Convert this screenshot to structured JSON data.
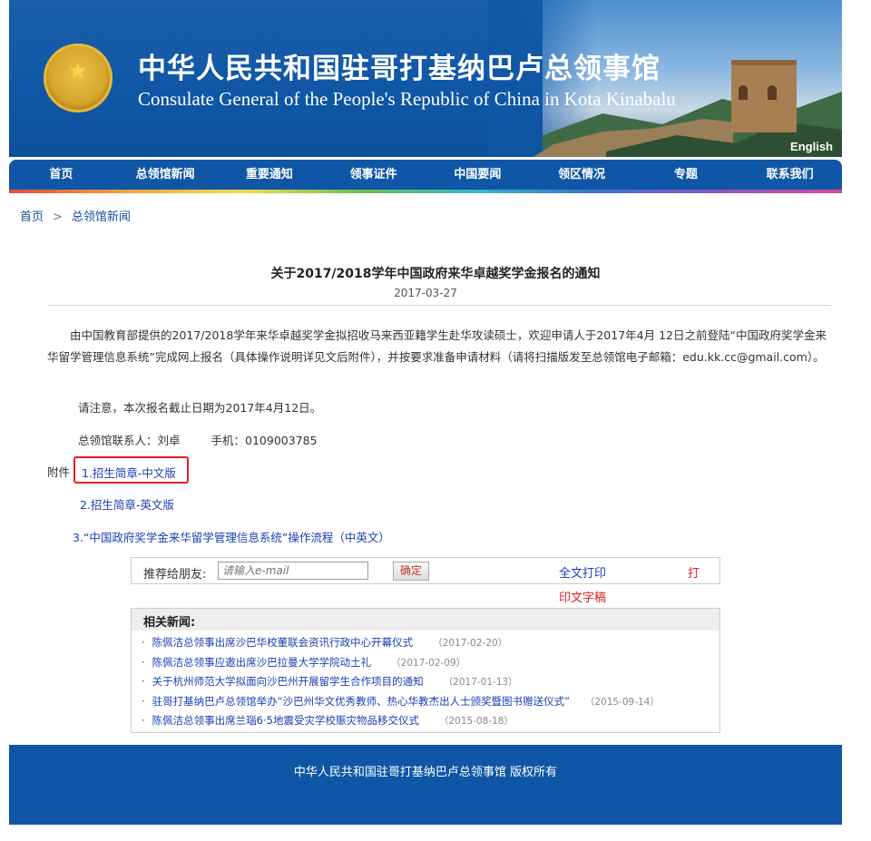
{
  "header": {
    "title_cn": "中华人民共和国驻哥打基纳巴卢总领事馆",
    "title_en": "Consulate General of the People's Republic of China in Kota Kinabalu",
    "english_link": "English",
    "emblem_icon": "national-emblem-icon"
  },
  "nav": {
    "items": [
      {
        "label": "首页"
      },
      {
        "label": "总领馆新闻"
      },
      {
        "label": "重要通知"
      },
      {
        "label": "领事证件"
      },
      {
        "label": "中国要闻"
      },
      {
        "label": "领区情况"
      },
      {
        "label": "专题"
      },
      {
        "label": "联系我们"
      }
    ]
  },
  "breadcrumb": {
    "home": "首页",
    "separator": ">",
    "current": "总领馆新闻"
  },
  "article": {
    "title": "关于2017/2018学年中国政府来华卓越奖学金报名的通知",
    "date": "2017-03-27",
    "para1": "由中国教育部提供的2017/2018学年来华卓越奖学金拟招收马来西亚籍学生赴华攻读硕士，欢迎申请人于2017年4月 12日之前登陆“中国政府奖学金来华留学管理信息系统”完成网上报名（具体操作说明详见文后附件），并按要求准备申请材料（请将扫描版发至总领馆电子邮箱：edu.kk.cc@gmail.com）。",
    "para2": "请注意，本次报名截止日期为2017年4月12日。",
    "contact_label": "总领馆联系人：刘卓",
    "phone_label": "手机：0109003785",
    "attachments_label": "附件",
    "attachments": [
      "1.招生简章-中文版",
      "2.招生简章-英文版",
      "3.“中国政府奖学金来华留学管理信息系统”操作流程（中英文）"
    ]
  },
  "recommend": {
    "label": "推荐给朋友:",
    "placeholder": "请输入e-mail",
    "button": "确定",
    "print_full": "全文打印",
    "print_part1": "打",
    "print_part2": "印文字稿"
  },
  "related": {
    "heading": "相关新闻:",
    "items": [
      {
        "title": "陈佩洁总领事出席沙巴华校董联会资讯行政中心开幕仪式",
        "date": "（2017-02-20）"
      },
      {
        "title": "陈佩洁总领事应邀出席沙巴拉曼大学学院动土礼",
        "date": "（2017-02-09）"
      },
      {
        "title": "关于杭州师范大学拟面向沙巴州开展留学生合作项目的通知",
        "date": "（2017-01-13）"
      },
      {
        "title": "驻哥打基纳巴卢总领馆举办“沙巴州华文优秀教师、热心华教杰出人士颁奖暨图书赠送仪式”",
        "date": "（2015-09-14）"
      },
      {
        "title": "陈佩洁总领事出席兰瑙6·5地震受灾学校赈灾物品移交仪式",
        "date": "（2015-08-18）"
      }
    ]
  },
  "footer": {
    "text": "中华人民共和国驻哥打基纳巴卢总领事馆  版权所有"
  },
  "colors": {
    "brand_blue": "#0f57a6",
    "link_blue": "#1a3fb4",
    "highlight_red": "#e02020"
  }
}
